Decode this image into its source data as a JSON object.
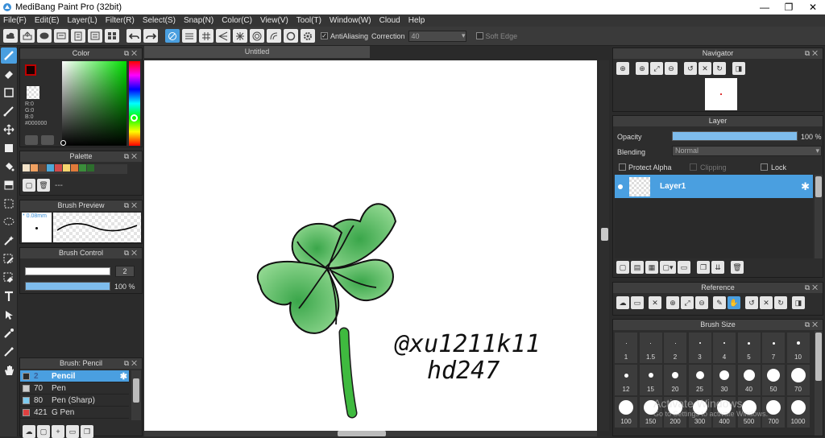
{
  "window": {
    "title": "MediBang Paint Pro (32bit)",
    "controls": [
      "—",
      "❐",
      "✕"
    ]
  },
  "menu": [
    "File(F)",
    "Edit(E)",
    "Layer(L)",
    "Filter(R)",
    "Select(S)",
    "Snap(N)",
    "Color(C)",
    "View(V)",
    "Tool(T)",
    "Window(W)",
    "Cloud",
    "Help"
  ],
  "toolbar": {
    "antialiasing_label": "AntiAliasing",
    "antialiasing_checked": true,
    "correction_label": "Correction",
    "correction_value": "40",
    "soft_edge_label": "Soft Edge",
    "soft_edge_checked": false
  },
  "color_panel": {
    "title": "Color",
    "r": "R:0",
    "g": "G:0",
    "b": "B:0",
    "hex": "#000000",
    "foreground": "#1a0000",
    "accent": "#c00000"
  },
  "palette_panel": {
    "title": "Palette",
    "swatches": [
      "#f3e3c9",
      "#f0a060",
      "#6d4a35",
      "#4fa8d8",
      "#d34b4b",
      "#f5d56e",
      "#e07a3a",
      "#3a8d3a",
      "#2d6e2d"
    ],
    "placeholder": "---"
  },
  "brush_preview": {
    "title": "Brush Preview",
    "size": "* 0.08mm"
  },
  "brush_control": {
    "title": "Brush Control",
    "size_value": "2",
    "opacity_value": "100 %",
    "opacity_percent": 100
  },
  "brush_list": {
    "title": "Brush: Pencil",
    "items": [
      {
        "size": "2",
        "name": "Pencil",
        "color": "#2b2b2b",
        "selected": true
      },
      {
        "size": "70",
        "name": "Pen",
        "color": "#cccccc",
        "selected": false
      },
      {
        "size": "80",
        "name": "Pen (Sharp)",
        "color": "#7ecbf0",
        "selected": false
      },
      {
        "size": "421",
        "name": "G Pen",
        "color": "#e04040",
        "selected": false
      }
    ]
  },
  "document": {
    "tab": "Untitled",
    "handwriting_line1": "@xu1211k11",
    "handwriting_line2": "hd247"
  },
  "navigator": {
    "title": "Navigator"
  },
  "layer_panel": {
    "title": "Layer",
    "opacity_label": "Opacity",
    "opacity_value": "100 %",
    "opacity_percent": 100,
    "blending_label": "Blending",
    "blending_value": "Normal",
    "protect_alpha_label": "Protect Alpha",
    "clipping_label": "Clipping",
    "lock_label": "Lock",
    "layers": [
      {
        "name": "Layer1",
        "selected": true
      }
    ]
  },
  "reference": {
    "title": "Reference"
  },
  "brush_size": {
    "title": "Brush Size",
    "row1": [
      "1",
      "1.5",
      "2",
      "3",
      "4",
      "5",
      "7",
      "10"
    ],
    "row2": [
      "12",
      "15",
      "20",
      "25",
      "30",
      "40",
      "50",
      "70"
    ],
    "row3": [
      "100",
      "150",
      "200",
      "300",
      "400",
      "500",
      "700",
      "1000"
    ]
  },
  "watermark": {
    "line1": "Activate Windows",
    "line2": "Go to Settings to activate Windows."
  }
}
